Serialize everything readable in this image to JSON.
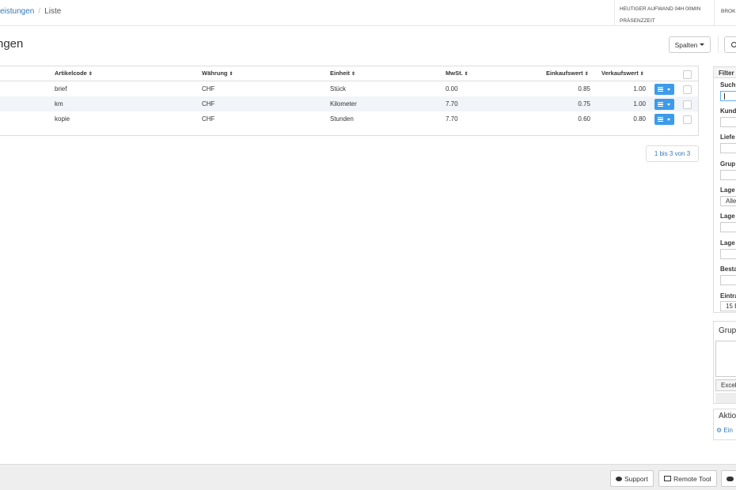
{
  "breadcrumb": {
    "parent": "eistungen",
    "separator": "/",
    "current": "Liste"
  },
  "topinfo": {
    "line1": "HEUTIGER AUFWAND 04H 00MIN",
    "line2": "PRÄSENZZEIT",
    "right": "BROK"
  },
  "page": {
    "title": "ngen"
  },
  "toolbar": {
    "columns_label": "Spalten"
  },
  "table": {
    "headers": {
      "artikelcode": "Artikelcode",
      "waehrung": "Währung",
      "einheit": "Einheit",
      "mwst": "MwSt.",
      "einkaufswert": "Einkaufswert",
      "verkaufswert": "Verkaufswert",
      "sort_glyph": "⇕"
    },
    "rows": [
      {
        "artikelcode": "brief",
        "waehrung": "CHF",
        "einheit": "Stück",
        "mwst": "0.00",
        "einkaufswert": "0.85",
        "verkaufswert": "1.00"
      },
      {
        "artikelcode": "km",
        "waehrung": "CHF",
        "einheit": "Kilometer",
        "mwst": "7.70",
        "einkaufswert": "0.75",
        "verkaufswert": "1.00"
      },
      {
        "artikelcode": "kopie",
        "waehrung": "CHF",
        "einheit": "Stunden",
        "mwst": "7.70",
        "einkaufswert": "0.60",
        "verkaufswert": "0.80"
      }
    ]
  },
  "pagination": {
    "label": "1 bis 3 von 3"
  },
  "filter": {
    "title": "Filter",
    "fields": [
      {
        "label": "Such",
        "value": ""
      },
      {
        "label": "Kund",
        "value": ""
      },
      {
        "label": "Liefe",
        "value": ""
      },
      {
        "label": "Grup",
        "value": ""
      },
      {
        "label": "Lage",
        "value": "Alle"
      },
      {
        "label": "Lage",
        "value": ""
      },
      {
        "label": "Lage",
        "value": ""
      },
      {
        "label": "Besta",
        "value": ""
      },
      {
        "label": "Eintra",
        "value": "15 E"
      }
    ]
  },
  "group_panel": {
    "title": "Grup",
    "excel_label": "Excel"
  },
  "actions_panel": {
    "title": "Aktio",
    "link_label": "Ein"
  },
  "footer": {
    "support_label": "Support",
    "remote_label": "Remote Tool"
  }
}
